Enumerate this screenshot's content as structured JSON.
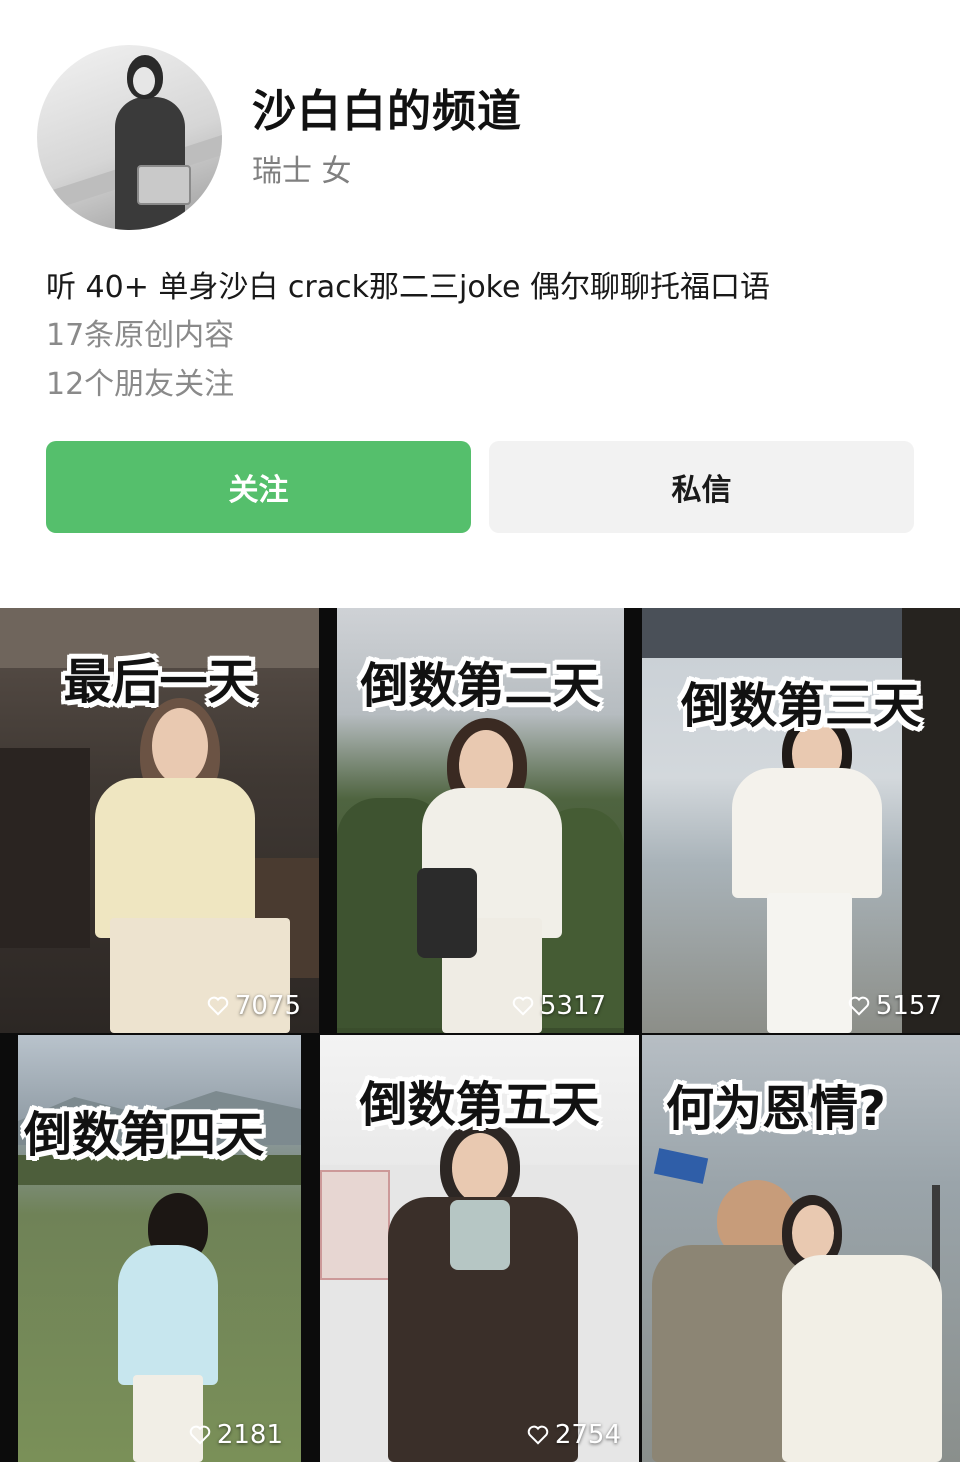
{
  "profile": {
    "name": "沙白白的频道",
    "location": "瑞士 女",
    "bio": "听 40+ 单身沙白 crack那二三joke 偶尔聊聊托福口语",
    "original_count": "17条原创内容",
    "friends_following": "12个朋友关注"
  },
  "actions": {
    "follow_label": "关注",
    "message_label": "私信"
  },
  "videos": [
    {
      "caption": "最后一天",
      "likes": "7075"
    },
    {
      "caption": "倒数第二天",
      "likes": "5317"
    },
    {
      "caption": "倒数第三天",
      "likes": "5157"
    },
    {
      "caption": "倒数第四天",
      "likes": "2181"
    },
    {
      "caption": "倒数第五天",
      "likes": "2754"
    },
    {
      "caption": "何为恩情?",
      "likes": ""
    }
  ],
  "colors": {
    "follow_button": "#55bf6c",
    "message_button": "#f2f2f2",
    "secondary_text": "#8a8a8a"
  }
}
